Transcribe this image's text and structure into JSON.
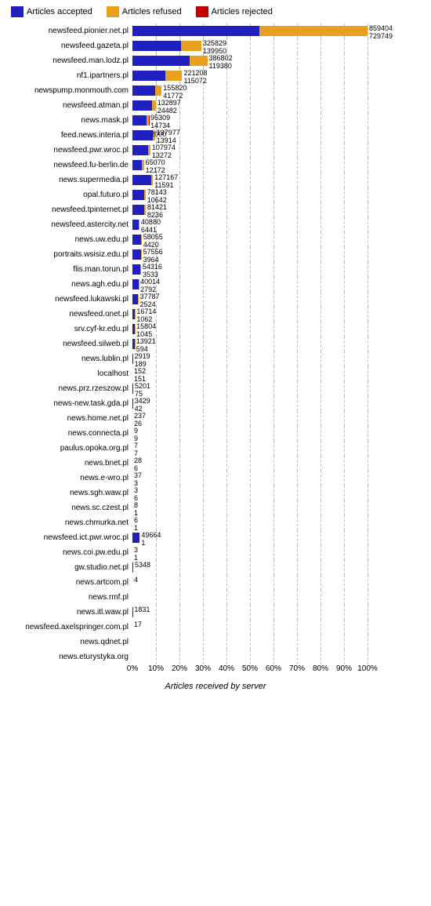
{
  "legend": {
    "items": [
      {
        "label": "Articles accepted",
        "color": "#2020c0"
      },
      {
        "label": "Articles refused",
        "color": "#e8a020"
      },
      {
        "label": "Articles rejected",
        "color": "#c00000"
      }
    ]
  },
  "xaxis": {
    "title": "Articles received by server",
    "labels": [
      "0%",
      "10%",
      "20%",
      "30%",
      "40%",
      "50%",
      "60%",
      "70%",
      "80%",
      "90%",
      "100%"
    ]
  },
  "maxVal": 1589153,
  "rows": [
    {
      "label": "newsfeed.pionier.net.pl",
      "accepted": 859404,
      "refused": 729749,
      "rejected": 0
    },
    {
      "label": "newsfeed.gazeta.pl",
      "accepted": 325829,
      "refused": 139950,
      "rejected": 0
    },
    {
      "label": "newsfeed.man.lodz.pl",
      "accepted": 386802,
      "refused": 119380,
      "rejected": 0
    },
    {
      "label": "nf1.ipartners.pl",
      "accepted": 221208,
      "refused": 115072,
      "rejected": 0
    },
    {
      "label": "newspump.monmouth.com",
      "accepted": 155820,
      "refused": 41772,
      "rejected": 0
    },
    {
      "label": "newsfeed.atman.pl",
      "accepted": 132897,
      "refused": 24482,
      "rejected": 0
    },
    {
      "label": "news.mask.pl",
      "accepted": 95309,
      "refused": 14734,
      "rejected": 2000
    },
    {
      "label": "feed.news.interia.pl",
      "accepted": 137977,
      "refused": 13914,
      "rejected": 0
    },
    {
      "label": "newsfeed.pwr.wroc.pl",
      "accepted": 107974,
      "refused": 13272,
      "rejected": 0
    },
    {
      "label": "newsfeed.fu-berlin.de",
      "accepted": 65070,
      "refused": 12172,
      "rejected": 0
    },
    {
      "label": "news.supermedia.pl",
      "accepted": 127167,
      "refused": 11591,
      "rejected": 0
    },
    {
      "label": "opal.futuro.pl",
      "accepted": 78143,
      "refused": 10642,
      "rejected": 0
    },
    {
      "label": "newsfeed.tpinternet.pl",
      "accepted": 81421,
      "refused": 8236,
      "rejected": 0
    },
    {
      "label": "newsfeed.astercity.net",
      "accepted": 40880,
      "refused": 6441,
      "rejected": 0
    },
    {
      "label": "news.uw.edu.pl",
      "accepted": 58055,
      "refused": 4420,
      "rejected": 0
    },
    {
      "label": "portraits.wsisiz.edu.pl",
      "accepted": 57556,
      "refused": 3964,
      "rejected": 0
    },
    {
      "label": "flis.man.torun.pl",
      "accepted": 54316,
      "refused": 3533,
      "rejected": 0
    },
    {
      "label": "news.agh.edu.pl",
      "accepted": 40014,
      "refused": 2792,
      "rejected": 0
    },
    {
      "label": "newsfeed.lukawski.pl",
      "accepted": 37787,
      "refused": 2524,
      "rejected": 0
    },
    {
      "label": "newsfeed.onet.pl",
      "accepted": 16714,
      "refused": 1062,
      "rejected": 0
    },
    {
      "label": "srv.cyf-kr.edu.pl",
      "accepted": 15804,
      "refused": 1045,
      "rejected": 0
    },
    {
      "label": "newsfeed.silweb.pl",
      "accepted": 13921,
      "refused": 594,
      "rejected": 0
    },
    {
      "label": "news.lublin.pl",
      "accepted": 2919,
      "refused": 189,
      "rejected": 0
    },
    {
      "label": "localhost",
      "accepted": 152,
      "refused": 151,
      "rejected": 0
    },
    {
      "label": "news.prz.rzeszow.pl",
      "accepted": 5201,
      "refused": 75,
      "rejected": 0
    },
    {
      "label": "news-new.task.gda.pl",
      "accepted": 3429,
      "refused": 42,
      "rejected": 0
    },
    {
      "label": "news.home.net.pl",
      "accepted": 237,
      "refused": 26,
      "rejected": 0
    },
    {
      "label": "news.connecta.pl",
      "accepted": 9,
      "refused": 9,
      "rejected": 0
    },
    {
      "label": "paulus.opoka.org.pl",
      "accepted": 7,
      "refused": 7,
      "rejected": 0
    },
    {
      "label": "news.bnet.pl",
      "accepted": 28,
      "refused": 6,
      "rejected": 0
    },
    {
      "label": "news.e-wro.pl",
      "accepted": 37,
      "refused": 3,
      "rejected": 0
    },
    {
      "label": "news.sgh.waw.pl",
      "accepted": 3,
      "refused": 6,
      "rejected": 0
    },
    {
      "label": "news.sc.czest.pl",
      "accepted": 8,
      "refused": 1,
      "rejected": 0
    },
    {
      "label": "news.chmurka.net",
      "accepted": 6,
      "refused": 1,
      "rejected": 0
    },
    {
      "label": "newsfeed.ict.pwr.wroc.pl",
      "accepted": 49664,
      "refused": 1,
      "rejected": 0
    },
    {
      "label": "news.coi.pw.edu.pl",
      "accepted": 3,
      "refused": 1,
      "rejected": 0
    },
    {
      "label": "gw.studio.net.pl",
      "accepted": 5348,
      "refused": 0,
      "rejected": 0
    },
    {
      "label": "news.artcom.pl",
      "accepted": 4,
      "refused": 0,
      "rejected": 0
    },
    {
      "label": "news.rmf.pl",
      "accepted": 0,
      "refused": 0,
      "rejected": 0
    },
    {
      "label": "news.itl.waw.pl",
      "accepted": 1831,
      "refused": 0,
      "rejected": 0
    },
    {
      "label": "newsfeed.axelspringer.com.pl",
      "accepted": 17,
      "refused": 0,
      "rejected": 0
    },
    {
      "label": "news.qdnet.pl",
      "accepted": 0,
      "refused": 0,
      "rejected": 0
    },
    {
      "label": "news.eturystyka.org",
      "accepted": 0,
      "refused": 0,
      "rejected": 0
    }
  ]
}
